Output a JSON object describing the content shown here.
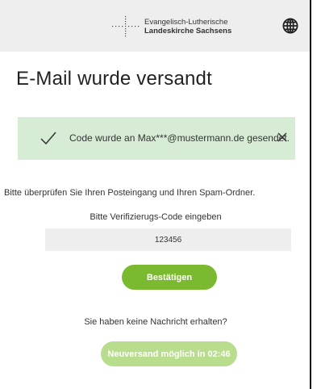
{
  "header": {
    "org_line1": "Evangelisch-Lutherische",
    "org_line2": "Landeskirche Sachsens",
    "logo_icon": "cross-dots-logo",
    "language_icon": "globe-icon"
  },
  "page": {
    "title": "E-Mail wurde versandt"
  },
  "alert": {
    "message": "Code wurde an Max***@mustermann.de gesendet.",
    "icon": "check-icon",
    "close_icon": "close-icon",
    "background": "#d7ecd5"
  },
  "form": {
    "hint": "Bitte überprüfen Sie Ihren Posteingang und Ihren Spam-Ordner.",
    "code_label": "Bitte Verifizierugs-Code eingeben",
    "code_value": "123456",
    "confirm_label": "Bestätigen",
    "no_message_text": "Sie haben keine Nachricht erhalten?",
    "resend_label": "Neuversand möglich in 02:46"
  },
  "colors": {
    "accent": "#7ab930",
    "accent_disabled": "#b8dd8d",
    "header_bg": "#eeeeee"
  }
}
